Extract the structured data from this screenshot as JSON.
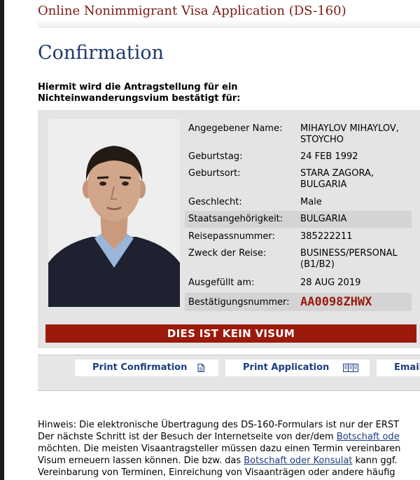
{
  "app_title": "Online Nonimmigrant Visa Application (DS-160)",
  "page_title": "Confirmation",
  "intro_line1": "Hiermit wird die Antragstellung für ein",
  "intro_line2": "Nichteinwanderungsvium bestätigt für:",
  "applicant": {
    "name_label": "Angegebener Name:",
    "name_value_1": "MIHAYLOV MIHAYLOV,",
    "name_value_2": "STOYCHO",
    "birthdate_label": "Geburtstag:",
    "birthdate_value": "24 FEB 1992",
    "birthplace_label": "Geburtsort:",
    "birthplace_value_1": "STARA ZAGORA,",
    "birthplace_value_2": "BULGARIA",
    "gender_label": "Geschlecht:",
    "gender_value": "Male",
    "nationality_label": "Staatsangehörigkeit:",
    "nationality_value": "BULGARIA",
    "passport_label": "Reisepassnummer:",
    "passport_value": "385222211",
    "purpose_label": "Zweck der Reise:",
    "purpose_value_1": "BUSINESS/PERSONAL",
    "purpose_value_2": "(B1/B2)",
    "completed_label": "Ausgefüllt am:",
    "completed_value": "28 AUG 2019",
    "confirmation_label": "Bestätigungsnummer:",
    "confirmation_value": "AA0098ZHWX"
  },
  "warning": "DIES IST KEIN VISUM",
  "buttons": {
    "print_confirmation": "Print Confirmation",
    "print_application": "Print Application",
    "email": "Email"
  },
  "icons": {
    "print_confirmation": "document-icon",
    "print_application": "pages-icon"
  },
  "colors": {
    "brand_red": "#9b1a0c",
    "title_blue": "#1e3a6e",
    "link_blue": "#1c3c80"
  },
  "notice": {
    "line1": "Hinweis: Die elektronische Übertragung des DS-160-Formulars ist nur der ERST",
    "line2_a": "Der nächste Schritt ist der Besuch der Internetseite von der/dem ",
    "line2_link": "Botschaft ode",
    "line3": "möchten. Die meisten Visaantragsteller müssen dazu einen Termin vereinbaren",
    "line4_a": "Visum erneuern lassen können. Die bzw. das ",
    "line4_link": "Botschaft oder Konsulat",
    "line4_b": " kann ggf.",
    "line5": "Vereinbarung von Terminen, Einreichung von Visaanträgen oder andere häufig"
  }
}
